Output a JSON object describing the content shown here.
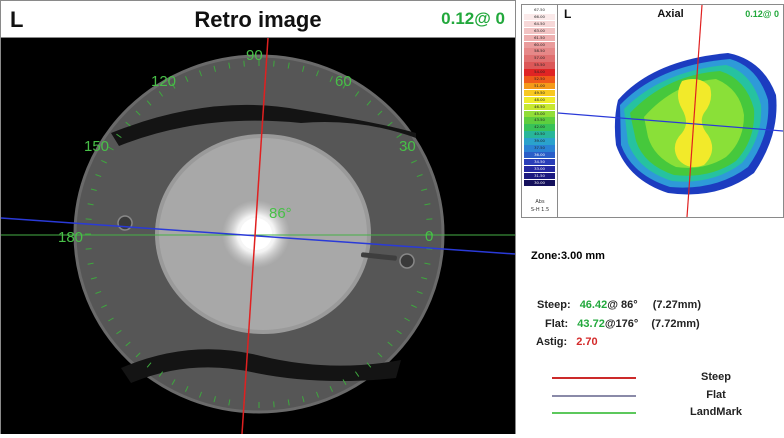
{
  "retro": {
    "eye": "L",
    "title": "Retro image",
    "value": "0.12@  0",
    "angle_labels": [
      "90",
      "60",
      "30",
      "0",
      "120",
      "150",
      "180"
    ],
    "marker_angle": "86°"
  },
  "axial": {
    "eye": "L",
    "title": "Axial",
    "value": "0.12@  0",
    "scale": [
      "67.50",
      "66.00",
      "64.50",
      "63.00",
      "61.50",
      "60.00",
      "58.50",
      "57.00",
      "55.50",
      "54.00",
      "52.50",
      "51.00",
      "49.50",
      "48.00",
      "46.50",
      "45.00",
      "43.50",
      "42.00",
      "40.50",
      "39.00",
      "37.50",
      "36.00",
      "34.50",
      "33.00",
      "31.50",
      "30.00"
    ],
    "scale_footer_1": "Abs",
    "scale_footer_2": "S-H 1.5"
  },
  "measurements": {
    "zone": "Zone:3.00 mm",
    "steep_label": "Steep:",
    "steep_value": "46.42",
    "steep_axis": "@ 86°",
    "steep_mm": "(7.27mm)",
    "flat_label": "Flat:",
    "flat_value": "43.72",
    "flat_axis": "@176°",
    "flat_mm": "(7.72mm)",
    "astig_label": "Astig:",
    "astig_value": "2.70"
  },
  "legend": {
    "steep": "Steep",
    "flat": "Flat",
    "landmark": "LandMark"
  },
  "colors": {
    "steep": "#cc2a2a",
    "flat": "#8a8aa8",
    "landmark": "#5cc85c"
  }
}
